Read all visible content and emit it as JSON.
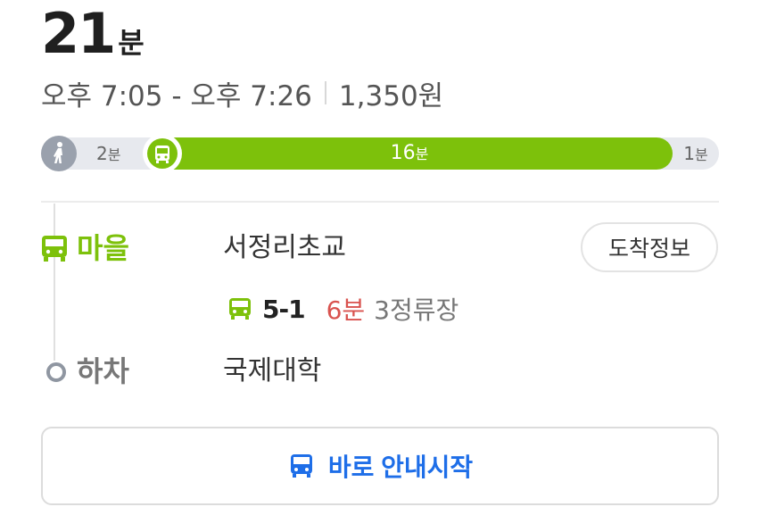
{
  "summary": {
    "duration_value": "21",
    "duration_unit": "분",
    "time_range": "오후 7:05 - 오후 7:26",
    "fare": "1,350원"
  },
  "segments": {
    "walk": {
      "value": "2",
      "unit": "분"
    },
    "bus": {
      "value": "16",
      "unit": "분"
    },
    "end": {
      "value": "1",
      "unit": "분"
    }
  },
  "board": {
    "type_label": "마을",
    "stop_name": "서정리초교",
    "arrival_info_button": "도착정보",
    "route_number": "5-1",
    "wait_time": "6분",
    "stops_count": "3정류장"
  },
  "alight": {
    "label": "하차",
    "stop_name": "국제대학"
  },
  "start_button": {
    "label": "바로 안내시작"
  },
  "colors": {
    "bus_green": "#7dc10b",
    "walk_gray": "#9aa1ad",
    "wait_red": "#d9534f",
    "start_blue": "#1e6ee8"
  },
  "icons": [
    "walk-icon",
    "bus-icon"
  ]
}
